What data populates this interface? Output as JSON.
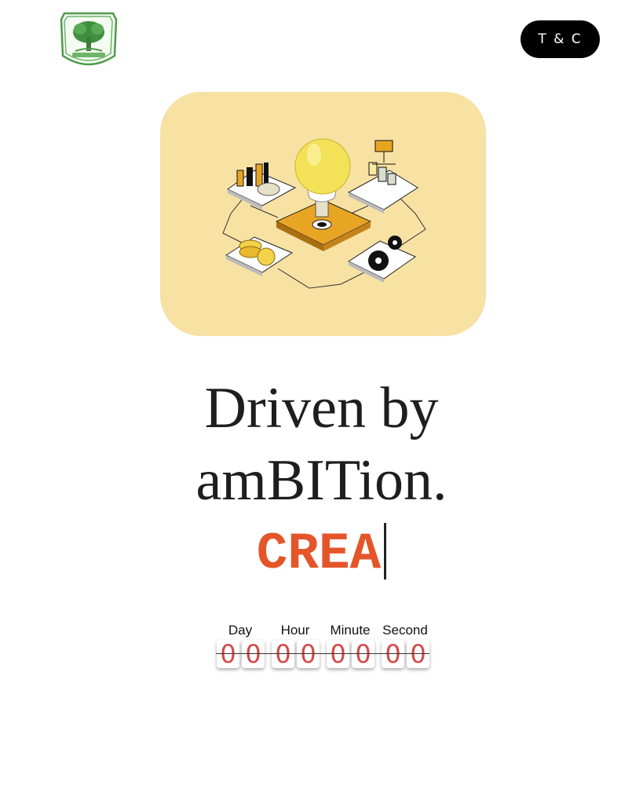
{
  "header": {
    "logo_icon": "college-crest-logo",
    "tc_label": "T & C"
  },
  "hero": {
    "illustration_icon": "isometric-idea-bulb-illustration",
    "background_color": "#f7e2a4"
  },
  "headline": {
    "line1": "Driven by",
    "line2": "amBITion."
  },
  "typing": {
    "text": "CREA",
    "color": "#e4552a"
  },
  "countdown": {
    "labels": [
      "Day",
      "Hour",
      "Minute",
      "Second"
    ],
    "digits": [
      "0",
      "0",
      "0",
      "0",
      "0",
      "0",
      "0",
      "0"
    ],
    "digit_color": "#d54848"
  }
}
